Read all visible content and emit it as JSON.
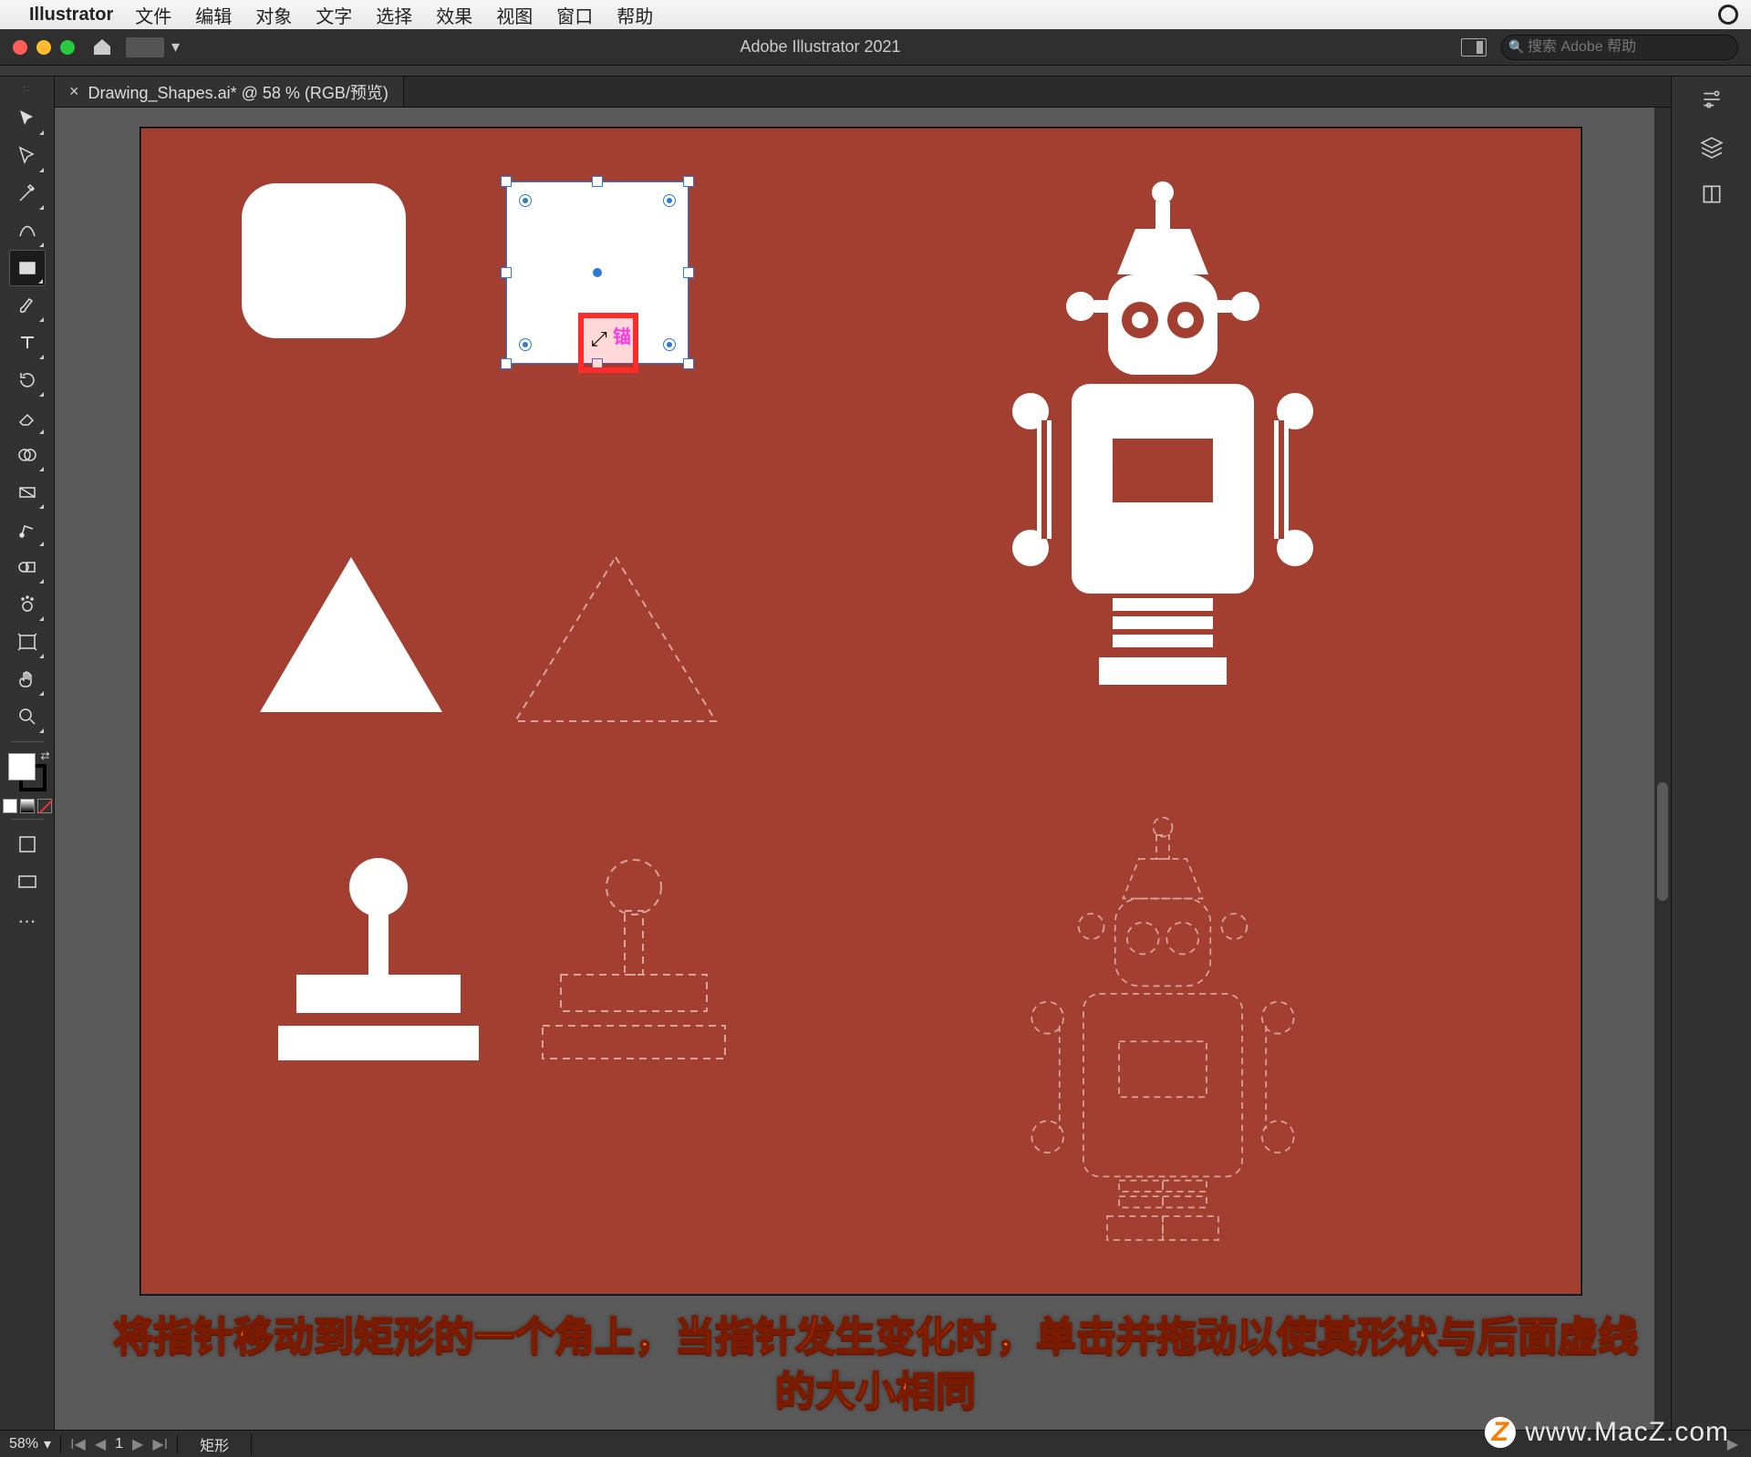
{
  "mac_menu": {
    "app": "Illustrator",
    "items": [
      "文件",
      "编辑",
      "对象",
      "文字",
      "选择",
      "效果",
      "视图",
      "窗口",
      "帮助"
    ]
  },
  "titlebar": {
    "title": "Adobe Illustrator 2021",
    "search_placeholder": "搜索 Adobe 帮助"
  },
  "document": {
    "tab_label": "Drawing_Shapes.ai* @ 58 % (RGB/预览)"
  },
  "callout": {
    "label": "锚"
  },
  "overlay": {
    "line1": "将指针移动到矩形的一个角上，当指针发生变化时，单击并拖动以使其形状与后面虚线",
    "line2": "的大小相同"
  },
  "watermark": "www.MacZ.com",
  "statusbar": {
    "zoom": "58%",
    "artboard_index": "1",
    "selection_tool": "矩形"
  },
  "tools": [
    {
      "name": "selection-tool",
      "glyph": "sel"
    },
    {
      "name": "direct-selection-tool",
      "glyph": "dsel"
    },
    {
      "name": "pen-tool",
      "glyph": "pen"
    },
    {
      "name": "curvature-tool",
      "glyph": "curv"
    },
    {
      "name": "rectangle-tool",
      "glyph": "rect",
      "selected": true
    },
    {
      "name": "paintbrush-tool",
      "glyph": "brush"
    },
    {
      "name": "type-tool",
      "glyph": "type"
    },
    {
      "name": "rotate-tool",
      "glyph": "rot"
    },
    {
      "name": "eraser-tool",
      "glyph": "eraser"
    },
    {
      "name": "shape-builder-tool",
      "glyph": "sb"
    },
    {
      "name": "gradient-tool",
      "glyph": "grad"
    },
    {
      "name": "eyedropper-tool",
      "glyph": "eye"
    },
    {
      "name": "blend-tool",
      "glyph": "blend"
    },
    {
      "name": "symbol-sprayer-tool",
      "glyph": "spray"
    },
    {
      "name": "artboard-tool",
      "glyph": "ab"
    },
    {
      "name": "hand-tool",
      "glyph": "hand"
    },
    {
      "name": "zoom-tool",
      "glyph": "zoom"
    }
  ],
  "right_panels": [
    {
      "name": "properties-icon"
    },
    {
      "name": "layers-icon"
    },
    {
      "name": "libraries-icon"
    }
  ],
  "colors": {
    "artboard_bg": "#a23f31",
    "selection_blue": "#2a7ad6",
    "callout_red": "#ff2a2a"
  }
}
